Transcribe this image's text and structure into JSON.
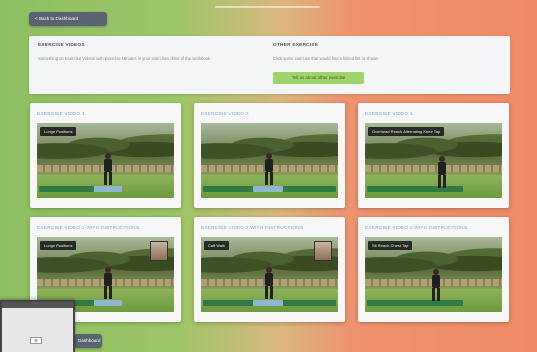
{
  "nav": {
    "back_label": "< Back to Dashboard",
    "back_label_bottom": "Dashboard"
  },
  "info": {
    "left": {
      "title": "EXERCISE VIDEOS",
      "text": "Something on Exercise Videos with Exercise Minutes in your exercises drive of the workbook"
    },
    "right": {
      "title": "OTHER EXERCISE",
      "text": "Click some exercise that would find a linked list or shown",
      "button_label": "Tell us about other exercise"
    }
  },
  "cards": [
    {
      "title": "EXERCISE VIDEO 1",
      "chip": "Lunge Positions",
      "scene": "a"
    },
    {
      "title": "EXERCISE VIDEO 2",
      "chip": "",
      "scene": "b"
    },
    {
      "title": "EXERCISE VIDEO 3",
      "chip": "Overhead Reach Alternating Knee Tap",
      "scene": "c"
    },
    {
      "title": "EXERCISE VIDEO 1 WITH INSTRUCTIONS",
      "chip": "Lunge Positions",
      "scene": "a"
    },
    {
      "title": "EXERCISE VIDEO 2 WITH INSTRUCTIONS",
      "chip": "Calf Walk",
      "scene": "b"
    },
    {
      "title": "EXERCISE VIDEO 3 WITH INSTRUCTIONS",
      "chip": "Sit Reach Chest Tap",
      "scene": "c"
    }
  ],
  "overlay": {
    "item_label": "☰"
  }
}
